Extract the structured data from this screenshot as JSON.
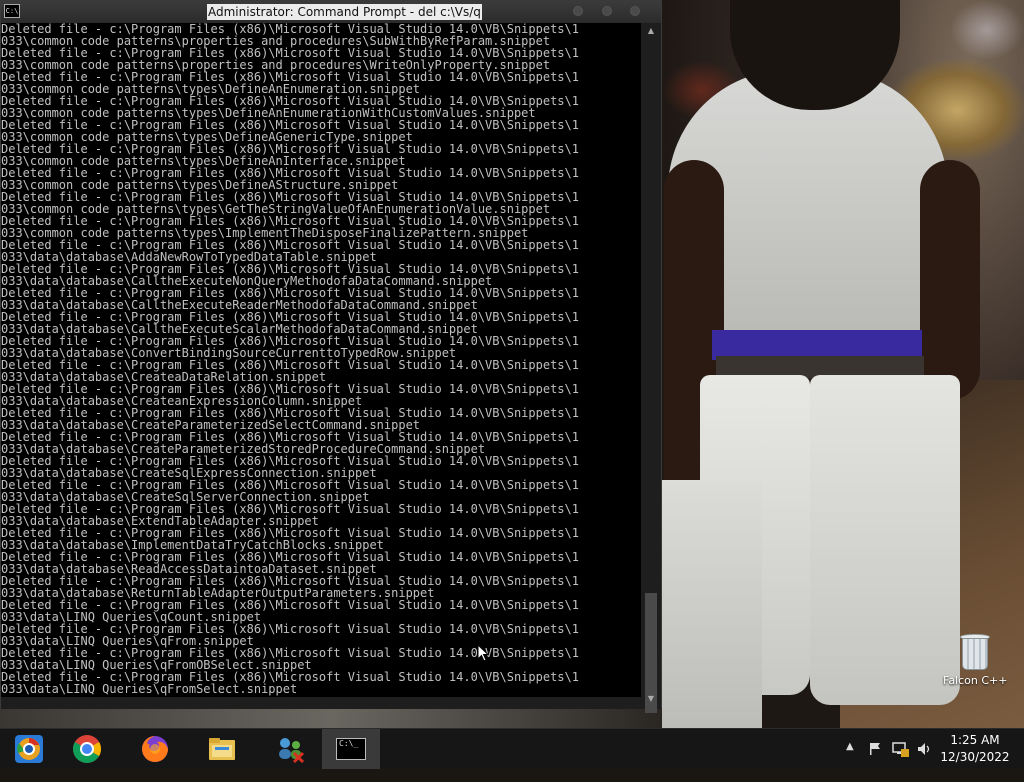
{
  "window": {
    "title": "Administrator: Command Prompt - del  c:\\Vs/q",
    "icon_text": "C:\\"
  },
  "console_lines": [
    "Deleted file - c:\\Program Files (x86)\\Microsoft Visual Studio 14.0\\VB\\Snippets\\1",
    "033\\common code patterns\\properties and procedures\\SubWithByRefParam.snippet",
    "Deleted file - c:\\Program Files (x86)\\Microsoft Visual Studio 14.0\\VB\\Snippets\\1",
    "033\\common code patterns\\properties and procedures\\WriteOnlyProperty.snippet",
    "Deleted file - c:\\Program Files (x86)\\Microsoft Visual Studio 14.0\\VB\\Snippets\\1",
    "033\\common code patterns\\types\\DefineAnEnumeration.snippet",
    "Deleted file - c:\\Program Files (x86)\\Microsoft Visual Studio 14.0\\VB\\Snippets\\1",
    "033\\common code patterns\\types\\DefineAnEnumerationWithCustomValues.snippet",
    "Deleted file - c:\\Program Files (x86)\\Microsoft Visual Studio 14.0\\VB\\Snippets\\1",
    "033\\common code patterns\\types\\DefineAGenericType.snippet",
    "Deleted file - c:\\Program Files (x86)\\Microsoft Visual Studio 14.0\\VB\\Snippets\\1",
    "033\\common code patterns\\types\\DefineAnInterface.snippet",
    "Deleted file - c:\\Program Files (x86)\\Microsoft Visual Studio 14.0\\VB\\Snippets\\1",
    "033\\common code patterns\\types\\DefineAStructure.snippet",
    "Deleted file - c:\\Program Files (x86)\\Microsoft Visual Studio 14.0\\VB\\Snippets\\1",
    "033\\common code patterns\\types\\GetTheStringValueOfAnEnumerationValue.snippet",
    "Deleted file - c:\\Program Files (x86)\\Microsoft Visual Studio 14.0\\VB\\Snippets\\1",
    "033\\common code patterns\\types\\ImplementTheDisposeFinalizePattern.snippet",
    "Deleted file - c:\\Program Files (x86)\\Microsoft Visual Studio 14.0\\VB\\Snippets\\1",
    "033\\data\\database\\AddaNewRowToTypedDataTable.snippet",
    "Deleted file - c:\\Program Files (x86)\\Microsoft Visual Studio 14.0\\VB\\Snippets\\1",
    "033\\data\\database\\CalltheExecuteNonQueryMethodofaDataCommand.snippet",
    "Deleted file - c:\\Program Files (x86)\\Microsoft Visual Studio 14.0\\VB\\Snippets\\1",
    "033\\data\\database\\CalltheExecuteReaderMethodofaDataCommand.snippet",
    "Deleted file - c:\\Program Files (x86)\\Microsoft Visual Studio 14.0\\VB\\Snippets\\1",
    "033\\data\\database\\CalltheExecuteScalarMethodofaDataCommand.snippet",
    "Deleted file - c:\\Program Files (x86)\\Microsoft Visual Studio 14.0\\VB\\Snippets\\1",
    "033\\data\\database\\ConvertBindingSourceCurrenttoTypedRow.snippet",
    "Deleted file - c:\\Program Files (x86)\\Microsoft Visual Studio 14.0\\VB\\Snippets\\1",
    "033\\data\\database\\CreateaDataRelation.snippet",
    "Deleted file - c:\\Program Files (x86)\\Microsoft Visual Studio 14.0\\VB\\Snippets\\1",
    "033\\data\\database\\CreateanExpressionColumn.snippet",
    "Deleted file - c:\\Program Files (x86)\\Microsoft Visual Studio 14.0\\VB\\Snippets\\1",
    "033\\data\\database\\CreateParameterizedSelectCommand.snippet",
    "Deleted file - c:\\Program Files (x86)\\Microsoft Visual Studio 14.0\\VB\\Snippets\\1",
    "033\\data\\database\\CreateParameterizedStoredProcedureCommand.snippet",
    "Deleted file - c:\\Program Files (x86)\\Microsoft Visual Studio 14.0\\VB\\Snippets\\1",
    "033\\data\\database\\CreateSqlExpressConnection.snippet",
    "Deleted file - c:\\Program Files (x86)\\Microsoft Visual Studio 14.0\\VB\\Snippets\\1",
    "033\\data\\database\\CreateSqlServerConnection.snippet",
    "Deleted file - c:\\Program Files (x86)\\Microsoft Visual Studio 14.0\\VB\\Snippets\\1",
    "033\\data\\database\\ExtendTableAdapter.snippet",
    "Deleted file - c:\\Program Files (x86)\\Microsoft Visual Studio 14.0\\VB\\Snippets\\1",
    "033\\data\\database\\ImplementDataTryCatchBlocks.snippet",
    "Deleted file - c:\\Program Files (x86)\\Microsoft Visual Studio 14.0\\VB\\Snippets\\1",
    "033\\data\\database\\ReadAccessDataintoaDataset.snippet",
    "Deleted file - c:\\Program Files (x86)\\Microsoft Visual Studio 14.0\\VB\\Snippets\\1",
    "033\\data\\database\\ReturnTableAdapterOutputParameters.snippet",
    "Deleted file - c:\\Program Files (x86)\\Microsoft Visual Studio 14.0\\VB\\Snippets\\1",
    "033\\data\\LINQ Queries\\qCount.snippet",
    "Deleted file - c:\\Program Files (x86)\\Microsoft Visual Studio 14.0\\VB\\Snippets\\1",
    "033\\data\\LINQ Queries\\qFrom.snippet",
    "Deleted file - c:\\Program Files (x86)\\Microsoft Visual Studio 14.0\\VB\\Snippets\\1",
    "033\\data\\LINQ Queries\\qFromOBSelect.snippet",
    "Deleted file - c:\\Program Files (x86)\\Microsoft Visual Studio 14.0\\VB\\Snippets\\1",
    "033\\data\\LINQ Queries\\qFromSelect.snippet"
  ],
  "desktop": {
    "recycle_bin_label": "Falcon C++"
  },
  "taskbar": {
    "pinned_icons": [
      "chrome-canary-icon",
      "chrome-icon",
      "firefox-icon",
      "file-explorer-icon",
      "network-people-icon",
      "command-prompt-icon"
    ],
    "active_app_icon_text": "C:\\_",
    "tray_icons": [
      "show-hidden-icons-chevron",
      "flag-icon",
      "network-icon",
      "volume-icon"
    ],
    "time": "1:25 AM",
    "date": "12/30/2022"
  },
  "colors": {
    "console_bg": "#000000",
    "console_text": "#c0c0c0",
    "taskbar_bg": "#161616",
    "titlebar_bg": "#2f2f2f"
  }
}
